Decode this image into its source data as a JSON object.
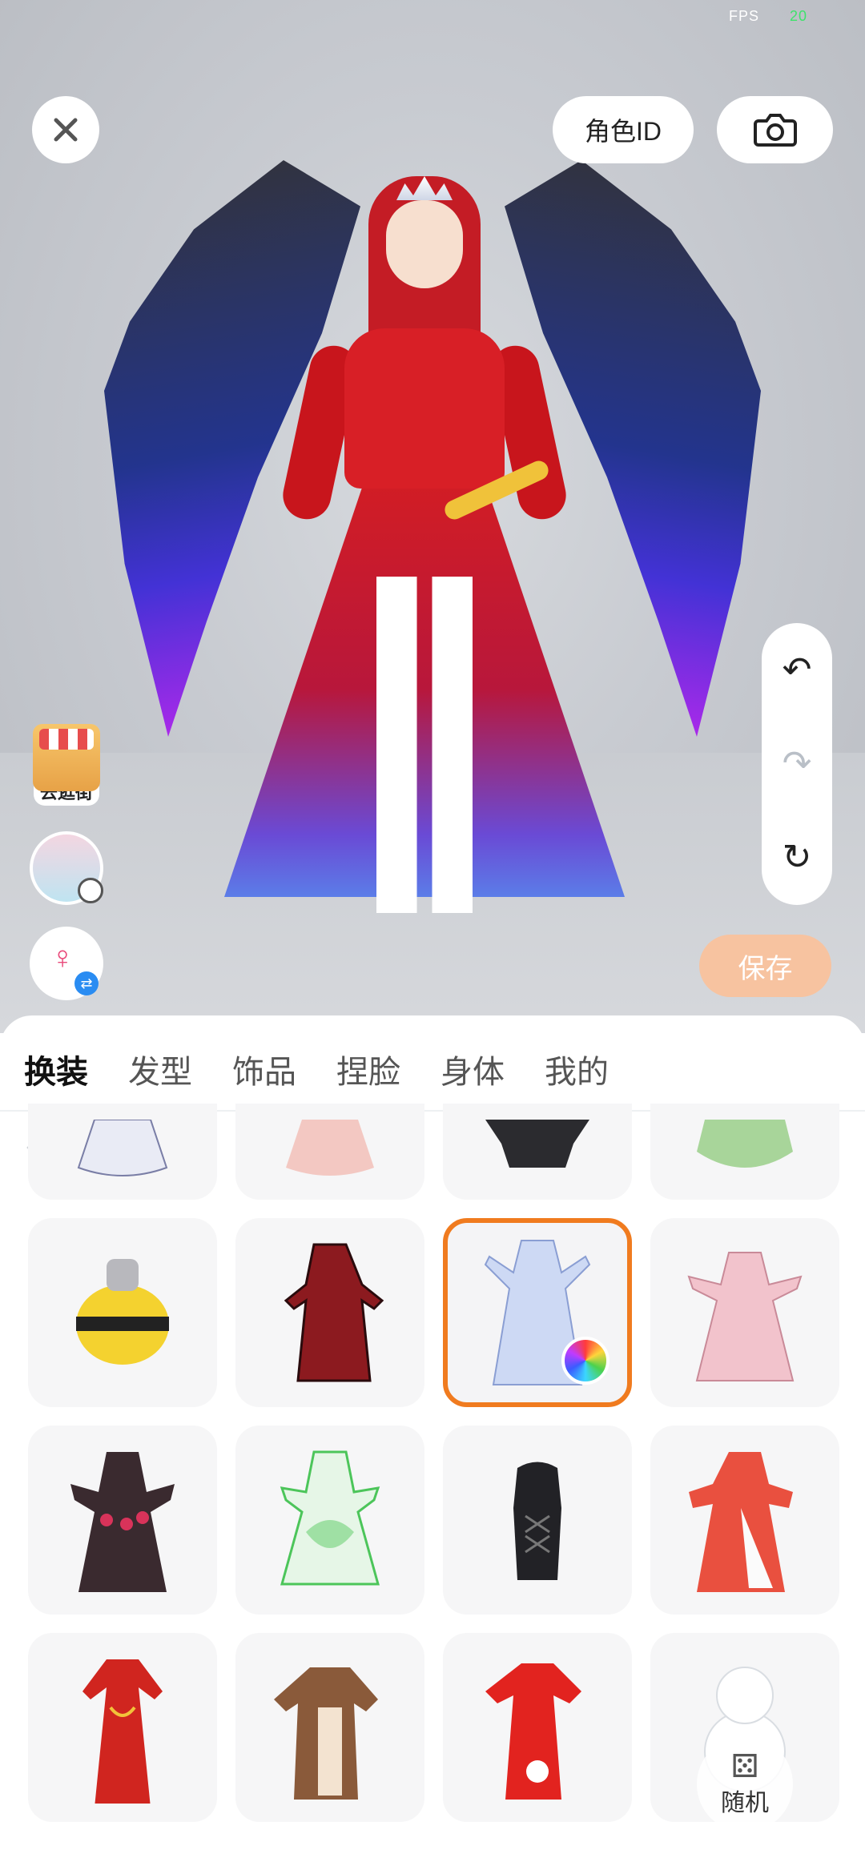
{
  "status": {
    "fps_label": "FPS",
    "fps_value": "20"
  },
  "top_bar": {
    "role_id_label": "角色ID"
  },
  "side_tools": {
    "shop_label": "去逛街"
  },
  "actions": {
    "save_label": "保存",
    "random_label": "随机"
  },
  "tabs": [
    {
      "label": "换装",
      "active": true
    },
    {
      "label": "发型",
      "active": false
    },
    {
      "label": "饰品",
      "active": false
    },
    {
      "label": "捏脸",
      "active": false
    },
    {
      "label": "身体",
      "active": false
    },
    {
      "label": "我的",
      "active": false
    }
  ],
  "subcategories": [
    {
      "icon": "full-outfit-icon",
      "active": false
    },
    {
      "icon": "top-shirt-icon",
      "active": true
    },
    {
      "icon": "pants-icon",
      "active": false
    },
    {
      "icon": "gloves-icon",
      "active": false
    },
    {
      "icon": "shoes-icon",
      "active": false
    }
  ],
  "items": [
    {
      "name": "white-lace-dress",
      "color": "#e9ebf5"
    },
    {
      "name": "pink-plaid-skirt",
      "color": "#f3c8c2"
    },
    {
      "name": "black-hoodie",
      "color": "#2b2b2f"
    },
    {
      "name": "green-frog-costume",
      "color": "#a8d59a"
    },
    {
      "name": "bee-costume",
      "color": "#f4d22f"
    },
    {
      "name": "red-black-coat",
      "color": "#8c1a1f"
    },
    {
      "name": "blue-white-gown",
      "color": "#cdd9f4",
      "selected": true
    },
    {
      "name": "pink-lolita-dress",
      "color": "#f2c3cc"
    },
    {
      "name": "black-rose-dress",
      "color": "#3a2a2f"
    },
    {
      "name": "green-flower-dress",
      "color": "#9fe0a4"
    },
    {
      "name": "black-corset",
      "color": "#222226"
    },
    {
      "name": "red-white-dress",
      "color": "#e9503f"
    },
    {
      "name": "red-qipao",
      "color": "#d0251f"
    },
    {
      "name": "brown-fur-coat",
      "color": "#8a5a3a"
    },
    {
      "name": "red-winter-qipao",
      "color": "#e2231f"
    },
    {
      "name": "snowman-outfit",
      "color": "#eef0f2"
    }
  ]
}
